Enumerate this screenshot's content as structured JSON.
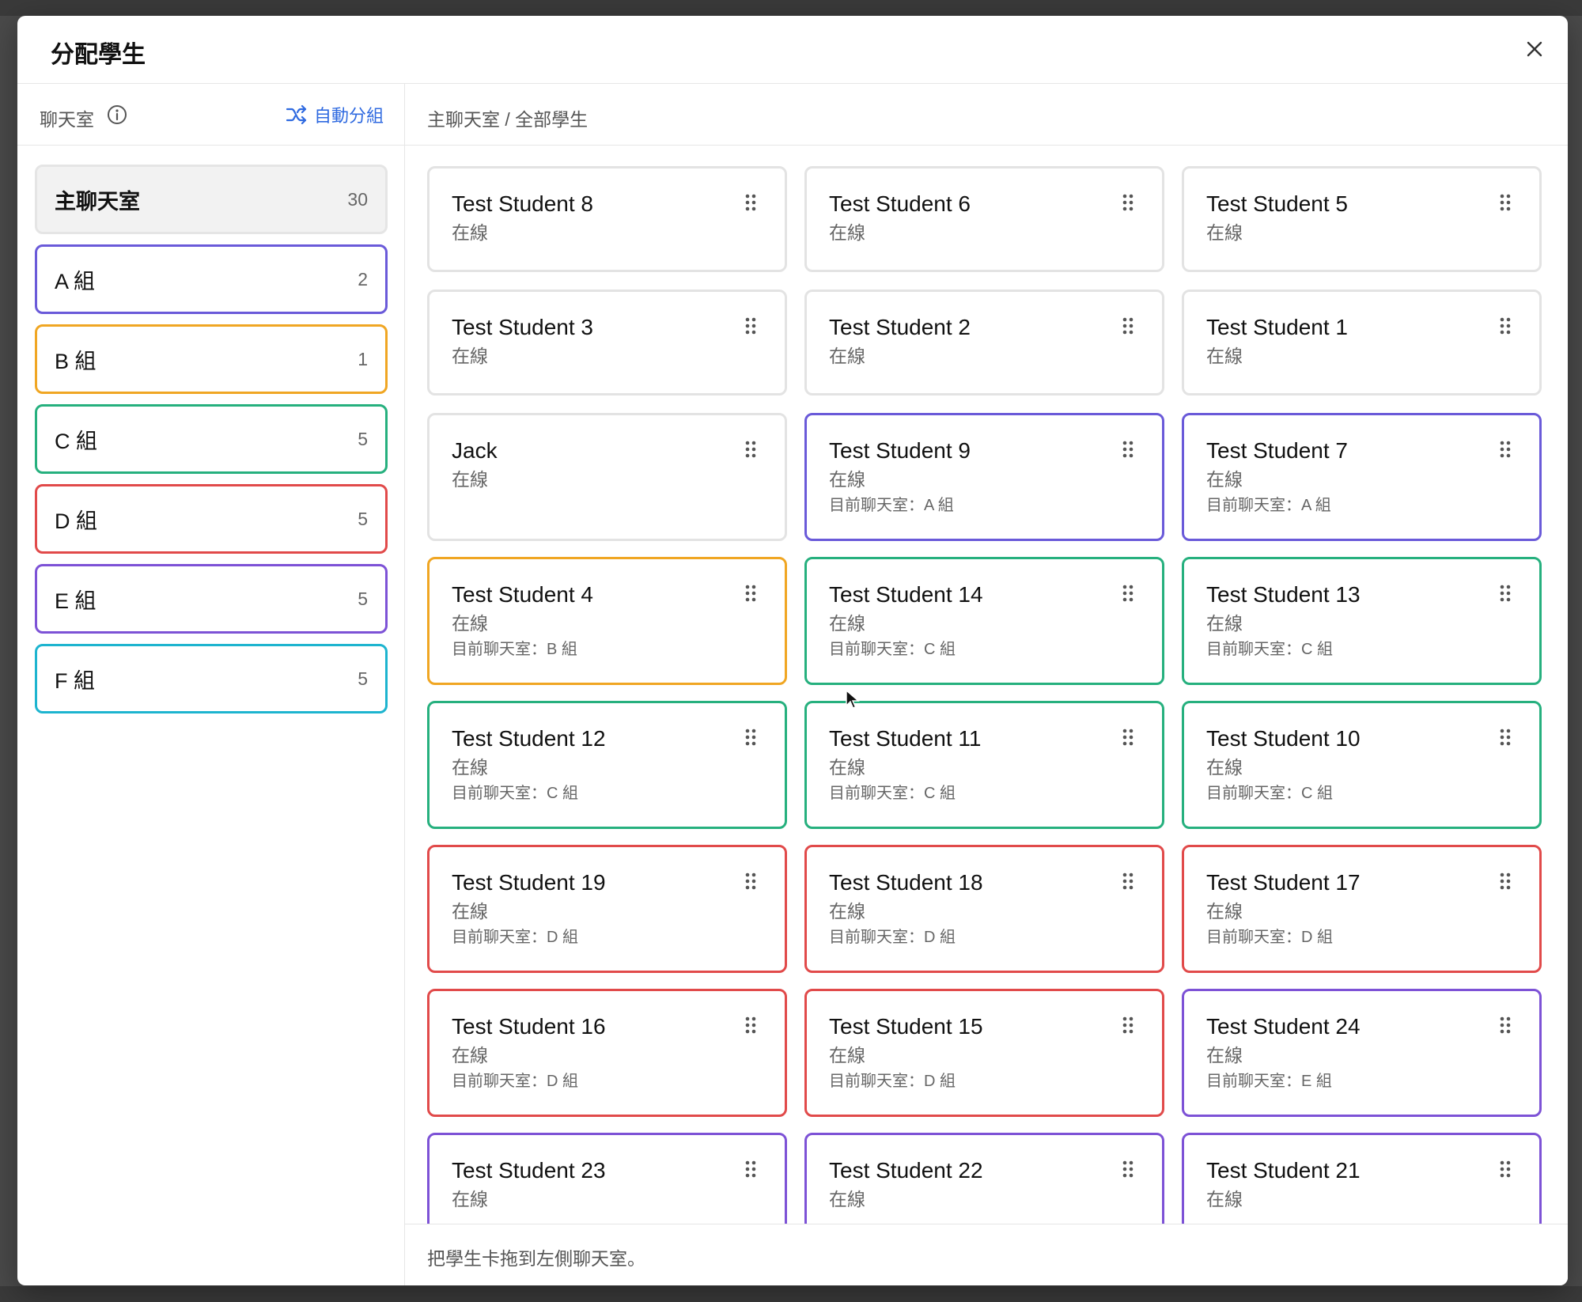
{
  "modal": {
    "title": "分配學生",
    "close_label": "×"
  },
  "left": {
    "title": "聊天室",
    "auto_group_label": "自動分組"
  },
  "rooms": [
    {
      "name": "主聊天室",
      "count": "30",
      "color": "#e5e5e5"
    },
    {
      "name": "A 組",
      "count": "2",
      "color": "#6a5ad9"
    },
    {
      "name": "B 組",
      "count": "1",
      "color": "#f0a623"
    },
    {
      "name": "C 組",
      "count": "5",
      "color": "#26b07e"
    },
    {
      "name": "D 組",
      "count": "5",
      "color": "#e14a4a"
    },
    {
      "name": "E 組",
      "count": "5",
      "color": "#7d52d6"
    },
    {
      "name": "F 組",
      "count": "5",
      "color": "#1db4cf"
    }
  ],
  "right": {
    "breadcrumb": "主聊天室 / 全部學生",
    "footer_hint": "把學生卡拖到左側聊天室。"
  },
  "students": [
    {
      "name": "Test Student 8",
      "status": "在線",
      "room": "",
      "color": "#e3e3e3"
    },
    {
      "name": "Test Student 6",
      "status": "在線",
      "room": "",
      "color": "#e3e3e3"
    },
    {
      "name": "Test Student 5",
      "status": "在線",
      "room": "",
      "color": "#e3e3e3"
    },
    {
      "name": "Test Student 3",
      "status": "在線",
      "room": "",
      "color": "#e3e3e3"
    },
    {
      "name": "Test Student 2",
      "status": "在線",
      "room": "",
      "color": "#e3e3e3"
    },
    {
      "name": "Test Student 1",
      "status": "在線",
      "room": "",
      "color": "#e3e3e3"
    },
    {
      "name": "Jack",
      "status": "在線",
      "room": "",
      "color": "#e3e3e3"
    },
    {
      "name": "Test Student 9",
      "status": "在線",
      "room": "目前聊天室：A 組",
      "color": "#6a5ad9"
    },
    {
      "name": "Test Student 7",
      "status": "在線",
      "room": "目前聊天室：A 組",
      "color": "#6a5ad9"
    },
    {
      "name": "Test Student 4",
      "status": "在線",
      "room": "目前聊天室：B 組",
      "color": "#f0a623"
    },
    {
      "name": "Test Student 14",
      "status": "在線",
      "room": "目前聊天室：C 組",
      "color": "#26b07e"
    },
    {
      "name": "Test Student 13",
      "status": "在線",
      "room": "目前聊天室：C 組",
      "color": "#26b07e"
    },
    {
      "name": "Test Student 12",
      "status": "在線",
      "room": "目前聊天室：C 組",
      "color": "#26b07e"
    },
    {
      "name": "Test Student 11",
      "status": "在線",
      "room": "目前聊天室：C 組",
      "color": "#26b07e"
    },
    {
      "name": "Test Student 10",
      "status": "在線",
      "room": "目前聊天室：C 組",
      "color": "#26b07e"
    },
    {
      "name": "Test Student 19",
      "status": "在線",
      "room": "目前聊天室：D 組",
      "color": "#e14a4a"
    },
    {
      "name": "Test Student 18",
      "status": "在線",
      "room": "目前聊天室：D 組",
      "color": "#e14a4a"
    },
    {
      "name": "Test Student 17",
      "status": "在線",
      "room": "目前聊天室：D 組",
      "color": "#e14a4a"
    },
    {
      "name": "Test Student 16",
      "status": "在線",
      "room": "目前聊天室：D 組",
      "color": "#e14a4a"
    },
    {
      "name": "Test Student 15",
      "status": "在線",
      "room": "目前聊天室：D 組",
      "color": "#e14a4a"
    },
    {
      "name": "Test Student 24",
      "status": "在線",
      "room": "目前聊天室：E 組",
      "color": "#7d52d6"
    },
    {
      "name": "Test Student 23",
      "status": "在線",
      "room": "",
      "color": "#7d52d6"
    },
    {
      "name": "Test Student 22",
      "status": "在線",
      "room": "",
      "color": "#7d52d6"
    },
    {
      "name": "Test Student 21",
      "status": "在線",
      "room": "",
      "color": "#7d52d6"
    }
  ]
}
